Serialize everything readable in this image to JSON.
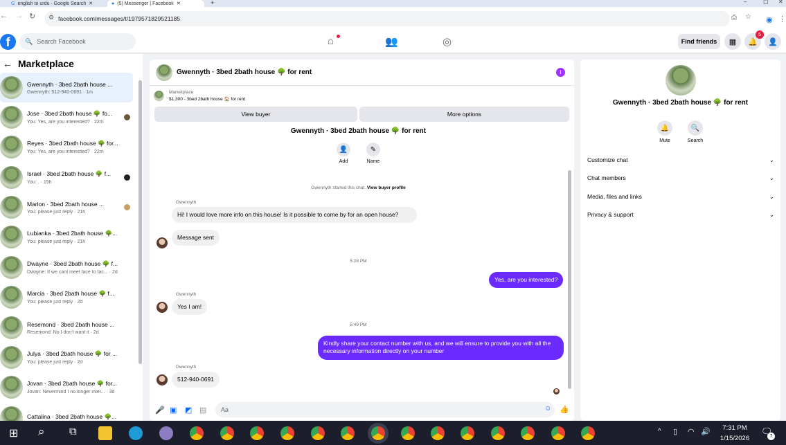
{
  "browser": {
    "tabs": [
      {
        "title": "english to urdu - Google Search"
      },
      {
        "title": "(5) Messenger | Facebook"
      }
    ],
    "url": "facebook.com/messages/t/1979571829521185"
  },
  "topbar": {
    "search_placeholder": "Search Facebook",
    "find_friends": "Find friends",
    "notification_count": "5"
  },
  "left": {
    "title": "Marketplace",
    "conversations": [
      {
        "name": "Gwennyth · 3bed 2bath house ...",
        "preview": "Gwennyth: 512-940-0691 · 1m"
      },
      {
        "name": "Jose · 3bed 2bath house 🌳 fo...",
        "preview": "You: Yes, are you interested? · 22m"
      },
      {
        "name": "Reyes · 3bed 2bath house 🌳 for...",
        "preview": "You: Yes, are you interested? · 22m"
      },
      {
        "name": "Israel · 3bed 2bath house 🌳 f...",
        "preview": "You: . · 15h"
      },
      {
        "name": "Marlon · 3bed 2bath house ...",
        "preview": "You: please just reply · 21h"
      },
      {
        "name": "Lubianka · 3bed 2bath house 🌳...",
        "preview": "You: please just reply · 21h"
      },
      {
        "name": "Dwayne · 3bed 2bath house 🌳 f...",
        "preview": "Dwayne: If we cant meet face to fac... · 2d"
      },
      {
        "name": "Marcia · 3bed 2bath house 🌳 f...",
        "preview": "You: please just reply · 2d"
      },
      {
        "name": "Resemond · 3bed 2bath house ...",
        "preview": "Resemond: No I don't want it · 2d"
      },
      {
        "name": "Julya · 3bed 2bath house 🌳 for ...",
        "preview": "You: please just reply · 2d"
      },
      {
        "name": "Jovan · 3bed 2bath house 🌳 for...",
        "preview": "Jovan: Nevermind I no longer inter... · 3d"
      },
      {
        "name": "Cattalina · 3bed 2bath house 🌳...",
        "preview": ""
      }
    ]
  },
  "chat": {
    "title": "Gwennyth · 3bed 2bath house 🌳 for rent",
    "listing_label": "Marketplace",
    "listing_detail": "$1,300 - 3bed 2bath house 🏠 for rent",
    "view_buyer": "View buyer",
    "more_options": "More options",
    "intro_title": "Gwennyth · 3bed 2bath house 🌳 for rent",
    "add_label": "Add",
    "name_label": "Name",
    "started_text": "Gwennyth started this chat.",
    "view_profile": "View buyer profile",
    "sender": "Gwennyth",
    "msg1": "Hi! I would love more info on this house! Is it possible to come by for an open house?",
    "msg2": "Message sent",
    "time1": "5:28 PM",
    "out1": "Yes, are you interested?",
    "msg3": "Yes I am!",
    "time2": "5:49 PM",
    "out2": "Kindly share your contact number with us, and we will ensure to provide you with all the necessary information directly on your number",
    "msg4": "512-940-0691",
    "composer_placeholder": "Aa"
  },
  "right": {
    "name": "Gwennyth · 3bed 2bath house 🌳 for rent",
    "mute": "Mute",
    "search": "Search",
    "rows": [
      "Customize chat",
      "Chat members",
      "Media, files and links",
      "Privacy & support"
    ]
  },
  "taskbar": {
    "time": "7:31 PM",
    "date": "1/15/2026",
    "notif": "7"
  },
  "colors": {
    "brand": "#1877f2",
    "outgoing": "#6b2bff",
    "accent": "#0866ff"
  }
}
